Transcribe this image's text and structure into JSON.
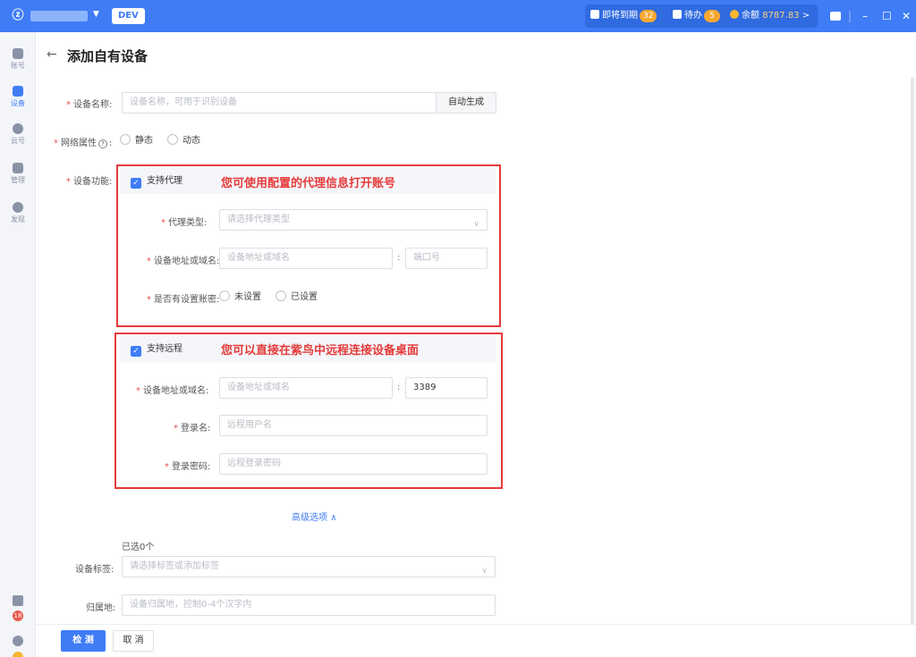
{
  "titlebar": {
    "env_label": "DEV",
    "expiring_label": "即将到期",
    "expiring_count": "32",
    "todo_label": "待办",
    "todo_count": "5",
    "balance_label": "余额",
    "balance_value": "8787.83",
    "balance_chevron": ">",
    "minimize": "–",
    "maximize": "☐",
    "close": "✕"
  },
  "sidebar": {
    "items": [
      {
        "label": "账号"
      },
      {
        "label": "设备"
      },
      {
        "label": "云号"
      },
      {
        "label": "管理"
      },
      {
        "label": "发现"
      }
    ],
    "badge": "18"
  },
  "header": {
    "back": "←",
    "title": "添加自有设备"
  },
  "form": {
    "device_name_label": "设备名称:",
    "device_name_placeholder": "设备名称，可用于识别设备",
    "auto_generate": "自动生成",
    "network_label": "网络属性",
    "network_help": "?",
    "network_static": "静态",
    "network_dynamic": "动态",
    "function_label": "设备功能:",
    "proxy": {
      "checkbox_label": "支持代理",
      "annotation": "您可使用配置的代理信息打开账号",
      "type_label": "代理类型:",
      "type_placeholder": "请选择代理类型",
      "address_label": "设备地址或域名:",
      "address_placeholder": "设备地址或域名",
      "port_placeholder": "端口号",
      "account_label": "是否有设置账密:",
      "account_unset": "未设置",
      "account_set": "已设置"
    },
    "remote": {
      "checkbox_label": "支持远程",
      "annotation": "您可以直接在紫鸟中远程连接设备桌面",
      "address_label": "设备地址或域名:",
      "address_placeholder": "设备地址或域名",
      "port_value": "3389",
      "login_label": "登录名:",
      "login_placeholder": "远程用户名",
      "password_label": "登录密码:",
      "password_placeholder": "远程登录密码"
    },
    "advanced": "高级选项",
    "selected_note": "已选0个",
    "tags_label": "设备标签:",
    "tags_placeholder": "请选择标签或添加标签",
    "location_label": "归属地:",
    "location_placeholder": "设备归属地，控制0-4个汉字内",
    "colon": ":"
  },
  "footer": {
    "check": "检 测",
    "cancel": "取 消"
  }
}
